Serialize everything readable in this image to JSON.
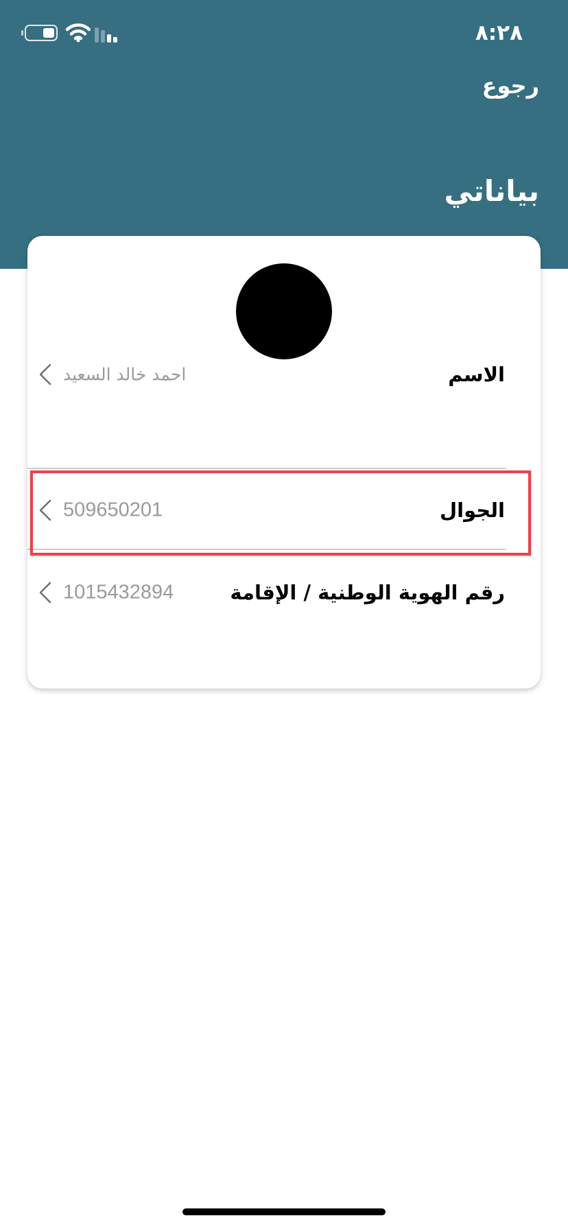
{
  "status_bar": {
    "time": "٨:٢٨",
    "icons": [
      "battery-icon",
      "wifi-icon",
      "cellular-signal-icon"
    ]
  },
  "header": {
    "back_label": "رجوع",
    "title": "بياناتي",
    "background_color": "#366f81"
  },
  "profile": {
    "avatar": "avatar-image",
    "rows": [
      {
        "label": "الاسم",
        "value": "احمد خالد السعيد",
        "icon": "chevron-left-icon"
      },
      {
        "label": "الجوال",
        "value": "509650201",
        "icon": "chevron-left-icon",
        "highlighted": true
      },
      {
        "label": "رقم الهوية الوطنية / الإقامة",
        "value": "1015432894",
        "icon": "chevron-left-icon"
      }
    ]
  },
  "colors": {
    "highlight": "#e8434a",
    "value_text": "#9a9a9a"
  }
}
